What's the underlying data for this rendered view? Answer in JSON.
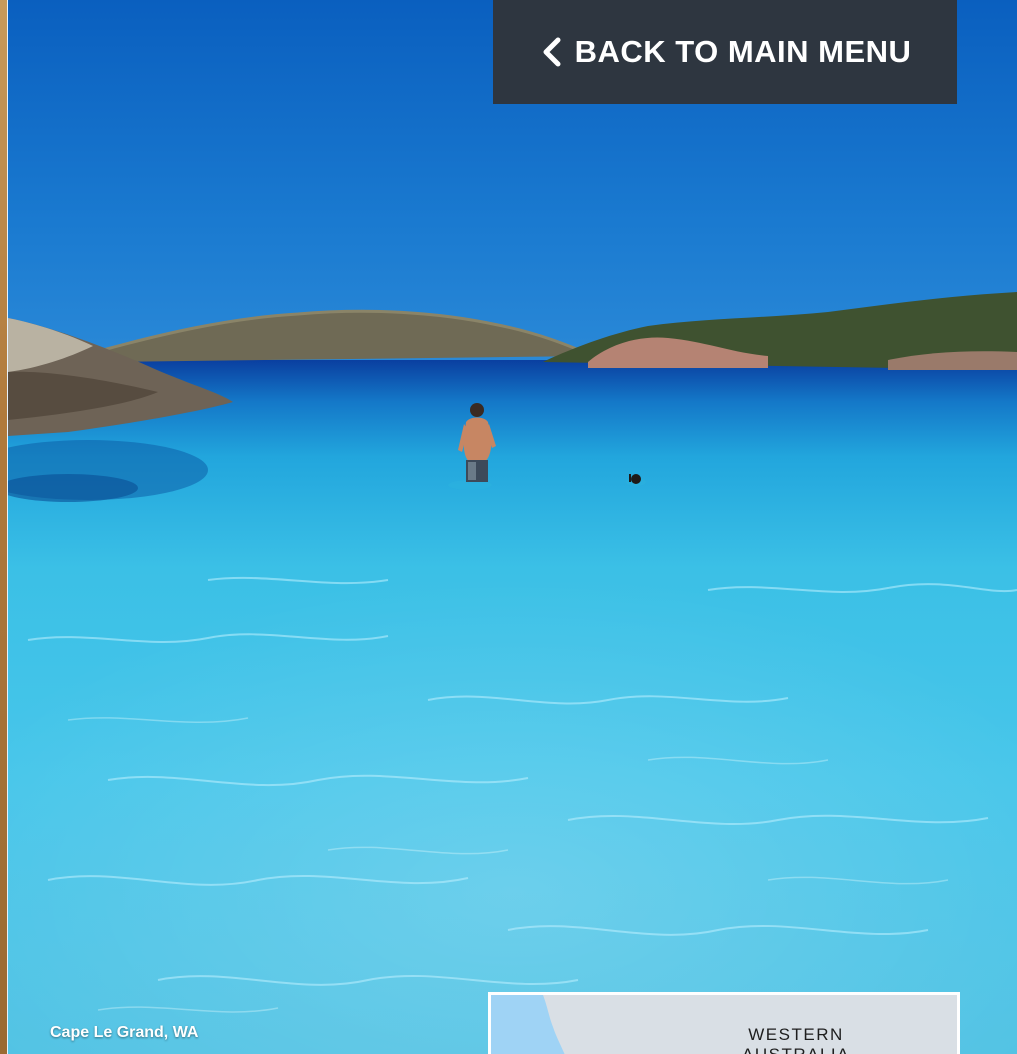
{
  "back_button": {
    "label": "BACK TO MAIN MENU",
    "icon": "chevron-left-icon"
  },
  "photo": {
    "caption": "Cape Le Grand, WA"
  },
  "map_inset": {
    "label_line1": "WESTERN",
    "label_line2": "AUSTRALIA"
  },
  "colors": {
    "button_bg": "#2e3640",
    "sky": "#0d64bf",
    "water_turquoise": "#3ec1e6",
    "deep_water": "#0a45a8"
  }
}
